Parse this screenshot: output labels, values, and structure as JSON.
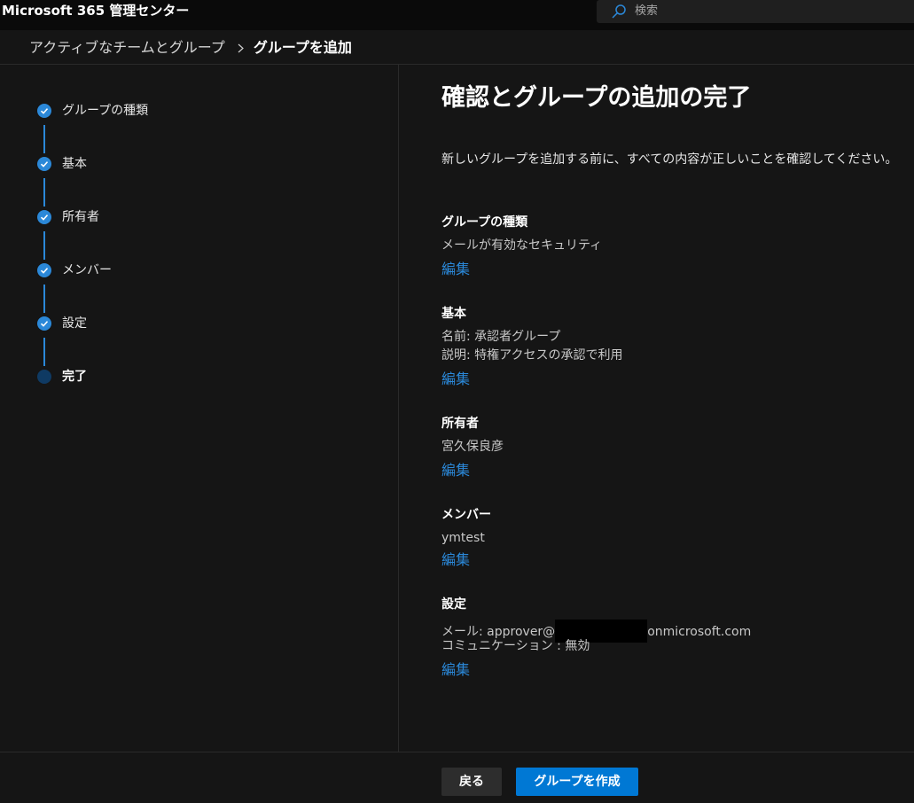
{
  "app": {
    "title": "Microsoft 365 管理センター"
  },
  "search": {
    "placeholder": "検索",
    "icon": "search-icon"
  },
  "breadcrumb": {
    "parent": "アクティブなチームとグループ",
    "current": "グループを追加"
  },
  "steps": [
    {
      "label": "グループの種類",
      "status": "completed"
    },
    {
      "label": "基本",
      "status": "completed"
    },
    {
      "label": "所有者",
      "status": "completed"
    },
    {
      "label": "メンバー",
      "status": "completed"
    },
    {
      "label": "設定",
      "status": "completed"
    },
    {
      "label": "完了",
      "status": "current"
    }
  ],
  "main": {
    "title": "確認とグループの追加の完了",
    "intro": "新しいグループを追加する前に、すべての内容が正しいことを確認してください。",
    "edit_label": "編集",
    "sections": {
      "group_type": {
        "heading": "グループの種類",
        "value": "メールが有効なセキュリティ"
      },
      "basics": {
        "heading": "基本",
        "name": "名前: 承認者グループ",
        "description": "説明: 特権アクセスの承認で利用"
      },
      "owners": {
        "heading": "所有者",
        "value": "宮久保良彦"
      },
      "members": {
        "heading": "メンバー",
        "value": "ymtest"
      },
      "settings": {
        "heading": "設定",
        "email_prefix": "メール: approver@",
        "email_suffix": "onmicrosoft.com",
        "communication": "コミュニケーション : 無効"
      }
    }
  },
  "footer": {
    "back_label": "戻る",
    "create_label": "グループを作成"
  },
  "colors": {
    "accent": "#0078d4",
    "link": "#2b88d8",
    "background": "#151515"
  }
}
